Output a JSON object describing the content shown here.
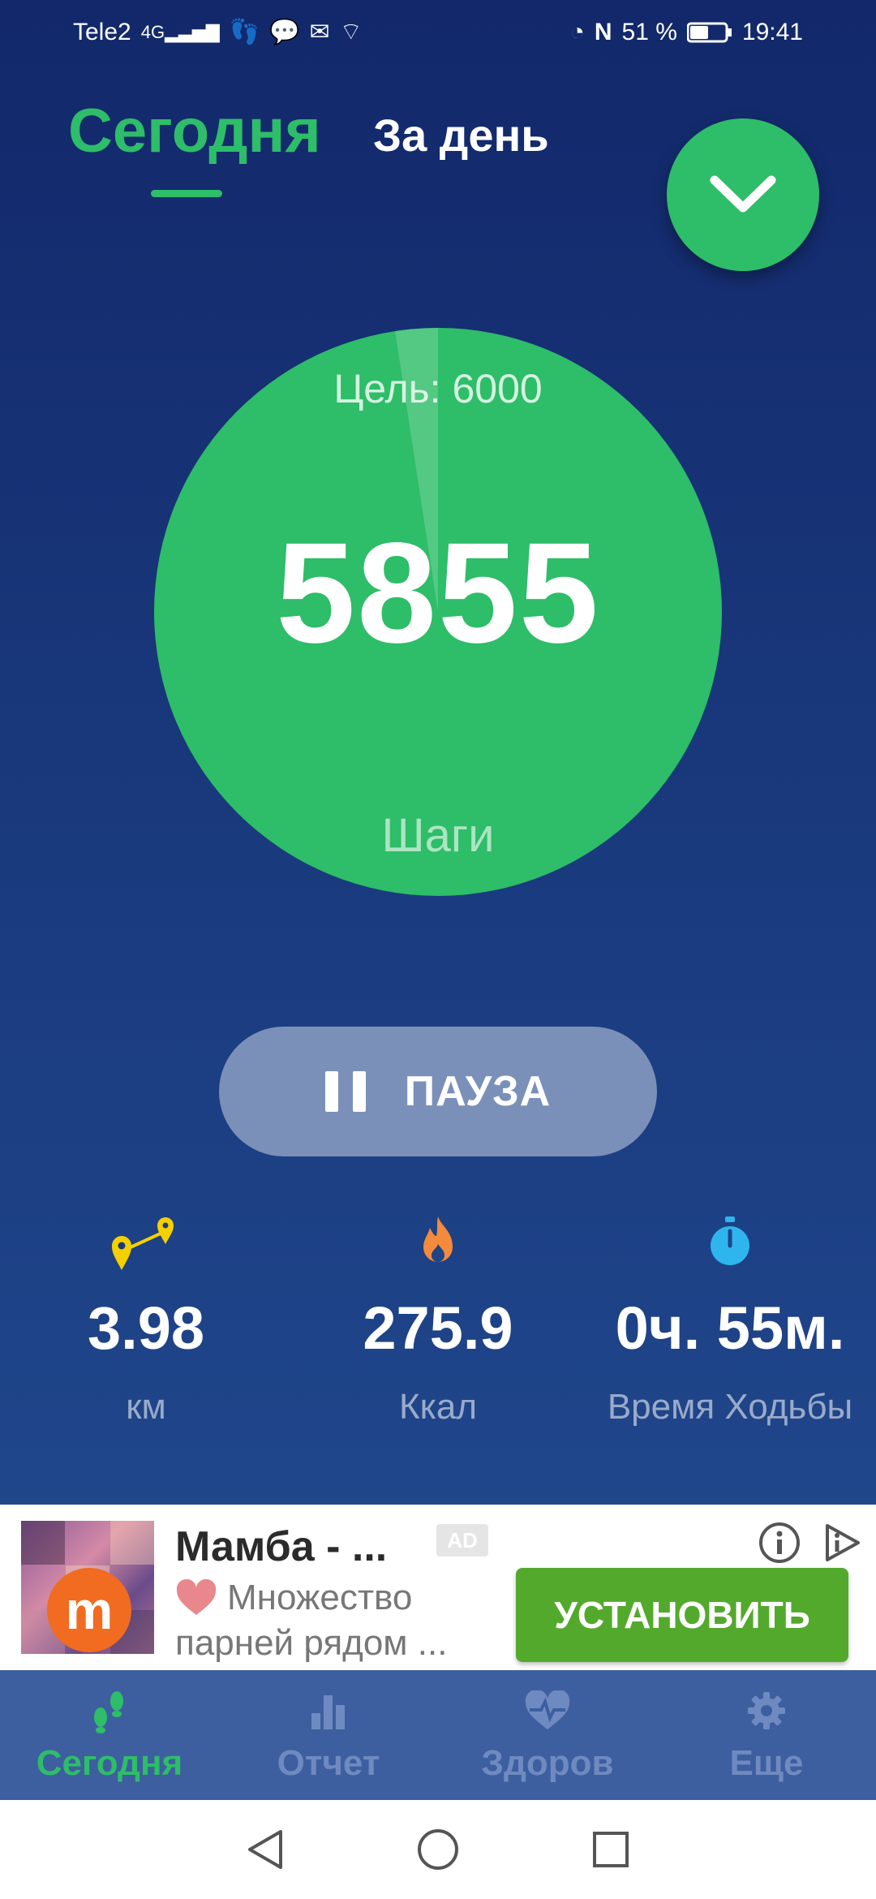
{
  "status_bar": {
    "carrier": "Tele2",
    "network": "4G",
    "battery": "51 %",
    "time": "19:41"
  },
  "tabs": {
    "today": "Сегодня",
    "per_day": "За день"
  },
  "steps": {
    "goal_text": "Цель: 6000",
    "value": "5855",
    "label": "Шаги",
    "goal": 6000,
    "progress": 5855
  },
  "pause": {
    "label": "ПАУЗА"
  },
  "stats": [
    {
      "value": "3.98",
      "label": "км",
      "icon": "route-icon"
    },
    {
      "value": "275.9",
      "label": "Ккал",
      "icon": "flame-icon"
    },
    {
      "value": "0ч. 55м.",
      "label": "Время Ходьбы",
      "icon": "stopwatch-icon"
    }
  ],
  "ad": {
    "title": "Мамба - ...",
    "badge": "AD",
    "desc_line1": "Множество",
    "desc_line2": "парней рядом ...",
    "install_label": "УСТАНОВИТЬ",
    "logo_letter": "m"
  },
  "bottom_nav": [
    {
      "label": "Сегодня",
      "icon": "footsteps-icon",
      "active": true
    },
    {
      "label": "Отчет",
      "icon": "bar-chart-icon",
      "active": false
    },
    {
      "label": "Здоров",
      "icon": "heart-pulse-icon",
      "active": false
    },
    {
      "label": "Еще",
      "icon": "gear-icon",
      "active": false
    }
  ],
  "colors": {
    "accent": "#2ebd68",
    "background_top": "#12286a",
    "background_bottom": "#234d92",
    "nav_bg": "#3d5fa0",
    "install_green": "#53a92c"
  }
}
